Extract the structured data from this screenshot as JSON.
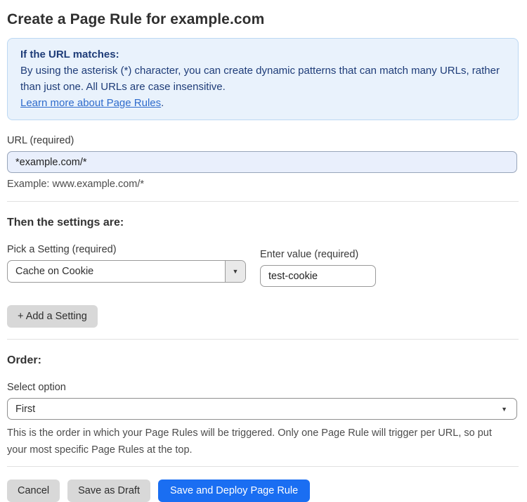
{
  "page": {
    "title": "Create a Page Rule for example.com"
  },
  "info_box": {
    "heading": "If the URL matches:",
    "body": "By using the asterisk (*) character, you can create dynamic patterns that can match many URLs, rather than just one. All URLs are case insensitive.",
    "link_label": "Learn more about Page Rules",
    "link_suffix": "."
  },
  "url_field": {
    "label": "URL (required)",
    "value": "*example.com/*",
    "example": "Example: www.example.com/*"
  },
  "settings": {
    "heading": "Then the settings are:",
    "setting_label": "Pick a Setting (required)",
    "setting_selected": "Cache on Cookie",
    "value_label": "Enter value (required)",
    "value_text": "test-cookie",
    "add_button_label": "+ Add a Setting"
  },
  "order": {
    "heading": "Order:",
    "select_label": "Select option",
    "selected_option": "First",
    "help_text": "This is the order in which your Page Rules will be triggered. Only one Page Rule will trigger per URL, so put your most specific Page Rules at the top."
  },
  "footer": {
    "cancel_label": "Cancel",
    "save_draft_label": "Save as Draft",
    "save_deploy_label": "Save and Deploy Page Rule"
  },
  "icons": {
    "chevron_down": "▼"
  },
  "colors": {
    "primary_button_blue": "#1a6ef2",
    "info_box_background": "#e9f2fc",
    "info_box_border": "#bcd8f3",
    "info_box_text": "#1e3c78",
    "link_blue": "#2e6bcc",
    "url_input_background": "#e9effc",
    "secondary_button_gray": "#d8d8d8"
  }
}
